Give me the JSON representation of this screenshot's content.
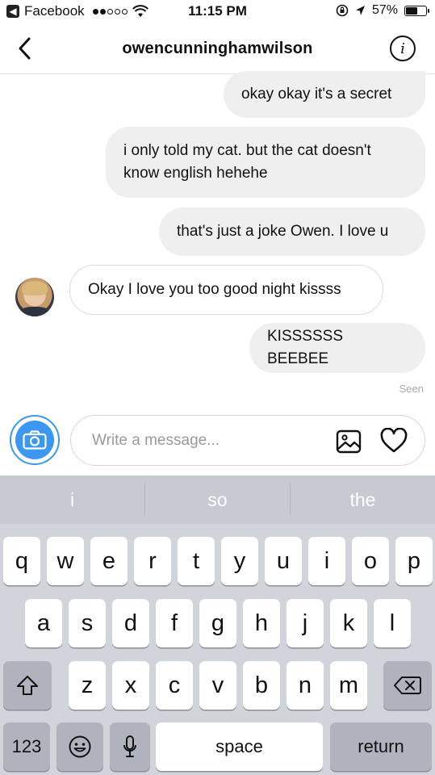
{
  "status_bar": {
    "back_app": "Facebook",
    "time": "11:15 PM",
    "battery": "57%",
    "battery_level": 0.57,
    "signal_bars": 2
  },
  "header": {
    "username": "owencunninghamwilson"
  },
  "messages": [
    {
      "direction": "outgoing",
      "text": "okay okay it's a secret"
    },
    {
      "direction": "outgoing",
      "text": "i only told my cat. but the cat doesn't know english hehehe"
    },
    {
      "direction": "outgoing",
      "text": "that's just a joke Owen. I love u"
    },
    {
      "direction": "incoming",
      "text": "Okay I love you too good night kissss"
    },
    {
      "direction": "outgoing",
      "text": "KISSSSSS BEEBEE"
    }
  ],
  "seen_label": "Seen",
  "composer": {
    "placeholder": "Write a message..."
  },
  "keyboard": {
    "suggestions": [
      "i",
      "so",
      "the"
    ],
    "row1": [
      "q",
      "w",
      "e",
      "r",
      "t",
      "y",
      "u",
      "i",
      "o",
      "p"
    ],
    "row2": [
      "a",
      "s",
      "d",
      "f",
      "g",
      "h",
      "j",
      "k",
      "l"
    ],
    "row3": [
      "z",
      "x",
      "c",
      "v",
      "b",
      "n",
      "m"
    ],
    "numbers_label": "123",
    "space_label": "space",
    "return_label": "return"
  },
  "colors": {
    "accent": "#3b97f0",
    "outgoing_bubble": "#efefef",
    "keyboard_bg": "#d1d4da"
  }
}
